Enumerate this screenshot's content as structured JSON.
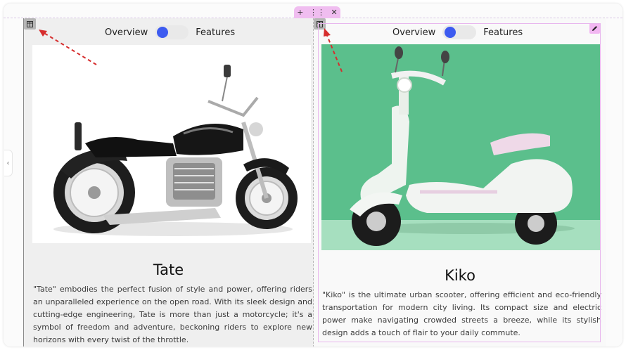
{
  "toolbar": {
    "add_glyph": "+",
    "drag_glyph": "⋮⋮",
    "close_glyph": "✕"
  },
  "side_handle": {
    "glyph": "‹"
  },
  "cards": [
    {
      "toggle_left": "Overview",
      "toggle_right": "Features",
      "title": "Tate",
      "description": "\"Tate\" embodies the perfect fusion of style and power, offering riders an unparalleled experience on the open road. With its sleek design and cutting-edge engineering, Tate is more than just a motorcycle; it's a symbol of freedom and adventure, beckoning riders to explore new horizons with every twist of the throttle.",
      "image_icon": "motorcycle-image"
    },
    {
      "toggle_left": "Overview",
      "toggle_right": "Features",
      "title": "Kiko",
      "description": "\"Kiko\" is the ultimate urban scooter, offering efficient and eco-friendly transportation for modern city living. Its compact size and electric power make navigating crowded streets a breeze, while its stylish design adds a touch of flair to your daily commute.",
      "image_icon": "scooter-image"
    }
  ],
  "colors": {
    "toggle_knob": "#3d5bf0",
    "toolbar_bg": "#f0bdf0",
    "scooter_bg": "#5bbf8c",
    "arrow": "#d62d2d"
  }
}
